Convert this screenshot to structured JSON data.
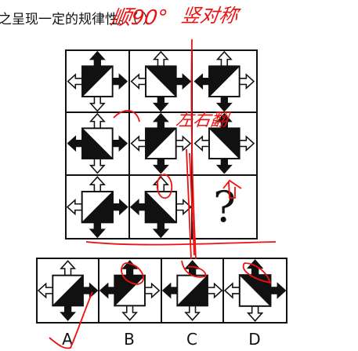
{
  "question_text": "之呈现一定的规律性。（ ）",
  "grid": [
    {
      "diag": "/",
      "black": "tl",
      "arrows": {
        "up": "filled",
        "left": "hollow",
        "right": "filled",
        "down": "hollow"
      }
    },
    {
      "diag": "\\",
      "black": "tr",
      "arrows": {
        "up": "hollow",
        "left": "hollow",
        "right": "filled",
        "down": "filled"
      }
    },
    {
      "diag": "/",
      "black": "tl",
      "arrows": {
        "up": "hollow",
        "left": "filled",
        "right": "hollow",
        "down": "filled"
      }
    },
    {
      "diag": "\\",
      "black": "bl",
      "arrows": {
        "up": "hollow",
        "left": "filled",
        "right": "filled",
        "down": "hollow"
      }
    },
    {
      "diag": "/",
      "black": "tl",
      "arrows": {
        "up": "filled",
        "left": "hollow",
        "right": "hollow",
        "down": "filled"
      }
    },
    {
      "diag": "\\",
      "black": "tr",
      "arrows": {
        "up": "filled",
        "left": "hollow",
        "right": "hollow",
        "down": "filled"
      }
    },
    {
      "diag": "/",
      "black": "br",
      "arrows": {
        "up": "hollow",
        "left": "hollow",
        "right": "filled",
        "down": "filled"
      }
    },
    {
      "diag": "\\",
      "black": "bl",
      "arrows": {
        "up": "hollow",
        "left": "filled",
        "right": "hollow",
        "down": "filled"
      }
    },
    {
      "question_mark": "?"
    }
  ],
  "options": [
    {
      "label": "A",
      "diag": "/",
      "black": "br",
      "arrows": {
        "up": "hollow",
        "left": "hollow",
        "right": "filled",
        "down": "filled"
      }
    },
    {
      "label": "B",
      "diag": "/",
      "black": "tl",
      "arrows": {
        "up": "filled",
        "left": "filled",
        "right": "hollow",
        "down": "hollow"
      }
    },
    {
      "label": "C",
      "diag": "/",
      "black": "br",
      "arrows": {
        "up": "filled",
        "left": "filled",
        "right": "hollow",
        "down": "hollow"
      }
    },
    {
      "label": "D",
      "diag": "\\",
      "black": "tr",
      "arrows": {
        "up": "filled",
        "left": "hollow",
        "right": "filled",
        "down": "hollow"
      }
    }
  ],
  "annotations": {
    "rotate_note": "顺90°",
    "vertical_symmetry_note": "竖对称",
    "flip_note": "左右翻",
    "color": "#e11"
  }
}
